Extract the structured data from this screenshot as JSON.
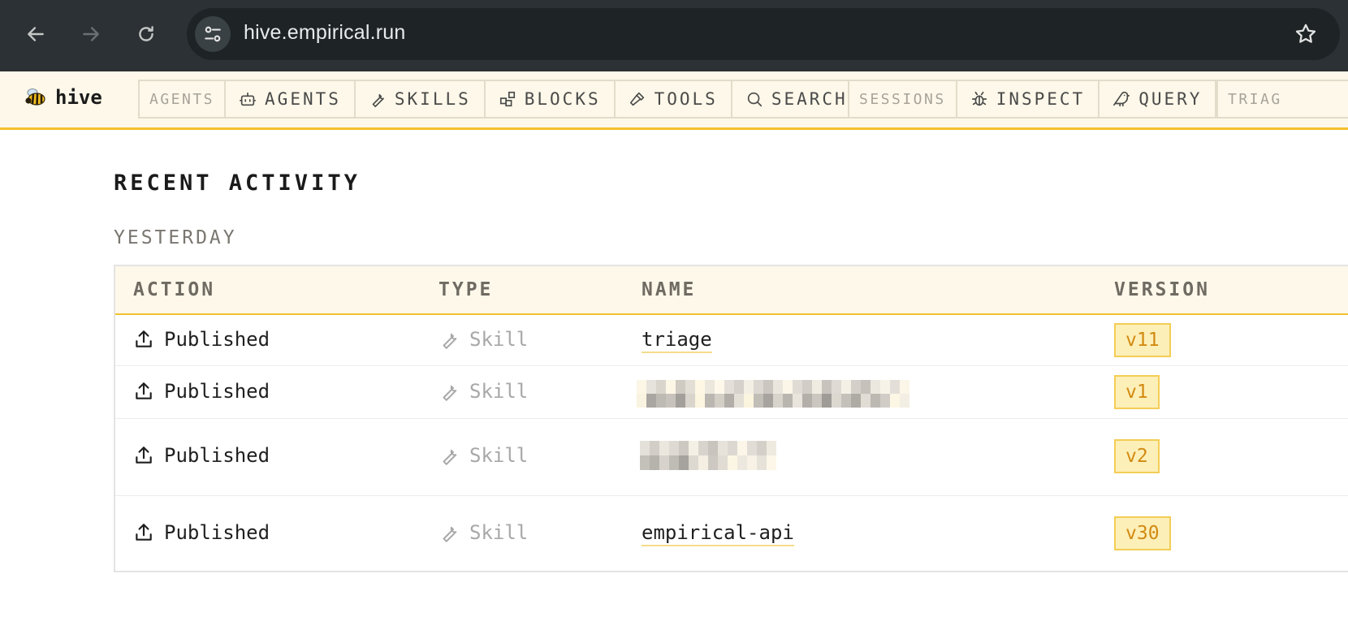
{
  "browser": {
    "url": "hive.empirical.run"
  },
  "app": {
    "logo_text": "hive",
    "nav_groups": [
      {
        "section_label": "AGENTS",
        "items": [
          {
            "label": "AGENTS",
            "icon": "bot-icon"
          },
          {
            "label": "SKILLS",
            "icon": "wrench-icon"
          },
          {
            "label": "BLOCKS",
            "icon": "blocks-icon"
          },
          {
            "label": "TOOLS",
            "icon": "hammer-icon"
          },
          {
            "label": "SEARCH",
            "icon": "search-icon"
          }
        ]
      },
      {
        "section_label": "SESSIONS",
        "items": [
          {
            "label": "INSPECT",
            "icon": "bug-icon"
          },
          {
            "label": "QUERY",
            "icon": "bird-icon"
          }
        ]
      },
      {
        "section_label": "TRIAG",
        "items": []
      }
    ]
  },
  "page": {
    "title": "RECENT ACTIVITY",
    "group_label": "YESTERDAY",
    "table": {
      "headers": {
        "action": "ACTION",
        "type": "TYPE",
        "name": "NAME",
        "version": "VERSION"
      },
      "rows": [
        {
          "action": "Published",
          "type": "Skill",
          "name": "triage",
          "name_redacted": false,
          "version": "v11"
        },
        {
          "action": "Published",
          "type": "Skill",
          "name": "",
          "name_redacted": true,
          "version": "v1"
        },
        {
          "action": "Published",
          "type": "Skill",
          "name": "",
          "name_redacted": true,
          "version": "v2"
        },
        {
          "action": "Published",
          "type": "Skill",
          "name": "empirical-api",
          "name_redacted": false,
          "version": "v30"
        }
      ]
    }
  },
  "colors": {
    "accent": "#f3c12c",
    "header_bg": "#fdf8e9",
    "badge_bg": "#fdefb8",
    "badge_text": "#d28a12",
    "chrome_bg": "#2b3134"
  }
}
